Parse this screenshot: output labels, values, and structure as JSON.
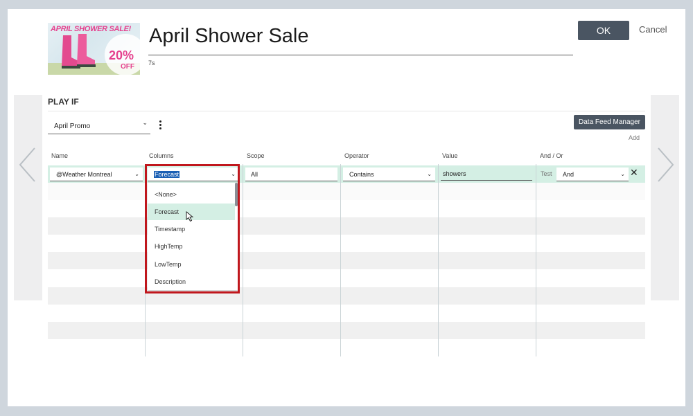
{
  "header": {
    "title": "April Shower Sale",
    "duration": "7s",
    "ok_label": "OK",
    "cancel_label": "Cancel",
    "thumbnail": {
      "sale_text": "APRIL SHOWER SALE!",
      "discount": "20%",
      "off": "OFF"
    }
  },
  "play_if": {
    "section_label": "PLAY IF",
    "rule_name": "April Promo",
    "data_feed_button": "Data Feed Manager",
    "add_label": "Add"
  },
  "table": {
    "headers": [
      "Name",
      "Columns",
      "Scope",
      "Operator",
      "Value",
      "And / Or"
    ],
    "row": {
      "name": "@Weather Montreal",
      "column": "Forecast",
      "scope": "All",
      "operator": "Contains",
      "value": "showers",
      "test_label": "Test",
      "and_or": "And"
    }
  },
  "dropdown": {
    "options": [
      "<None>",
      "Forecast",
      "Timestamp",
      "HighTemp",
      "LowTemp",
      "Description"
    ],
    "hovered": "Forecast"
  },
  "colors": {
    "primary_button": "#4a5562",
    "row_highlight": "#d4efe4",
    "annotation_box": "#c0171d",
    "selection": "#1a5fb4"
  },
  "icons": [
    "chevron-left-icon",
    "chevron-right-icon",
    "kebab-menu-icon",
    "close-icon",
    "chevron-down-icon",
    "mouse-cursor-icon"
  ]
}
